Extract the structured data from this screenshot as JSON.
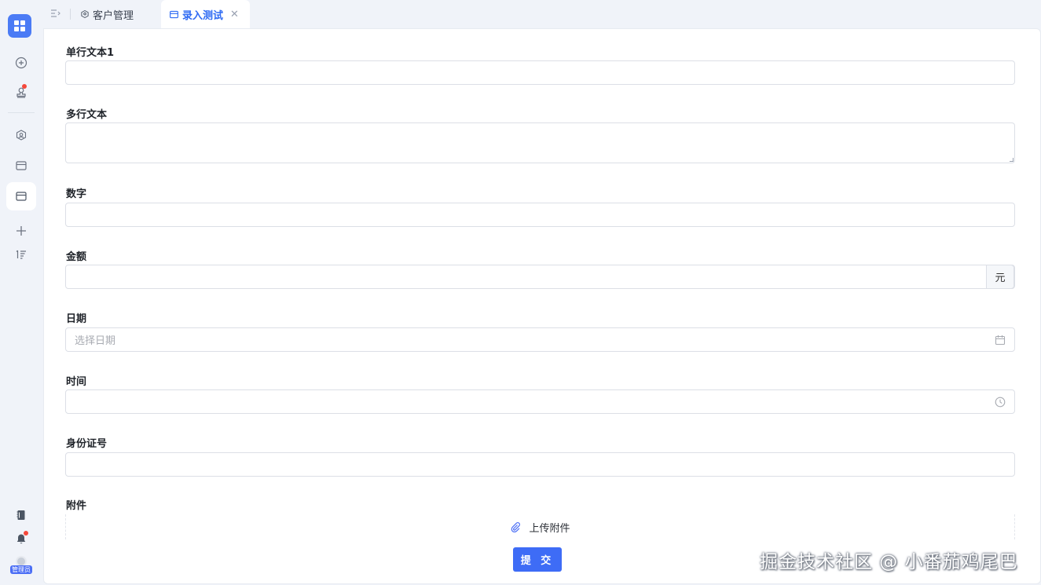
{
  "tabs": {
    "customer": "客户管理",
    "entry_test": "录入测试",
    "close_glyph": "✕"
  },
  "form": {
    "single_line_label": "单行文本1",
    "multi_line_label": "多行文本",
    "number_label": "数字",
    "amount_label": "金额",
    "amount_suffix": "元",
    "date_label": "日期",
    "date_placeholder": "选择日期",
    "time_label": "时间",
    "id_label": "身份证号",
    "attachment_label": "附件",
    "upload_label": "上传附件",
    "submit_label": "提 交"
  },
  "sidebar": {
    "user_label": "管理员"
  },
  "watermark": "掘金技术社区 @ 小番茄鸡尾巴",
  "colors": {
    "accent": "#3e6cf6",
    "badge": "#f5483b"
  }
}
